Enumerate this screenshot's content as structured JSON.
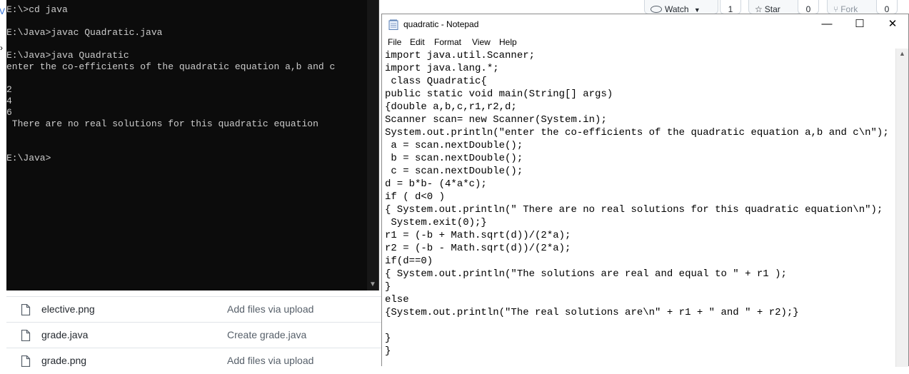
{
  "github": {
    "watch_label": "Watch",
    "watch_count": "1",
    "star_label": "Star",
    "star_count": "0",
    "fork_label": "Fork",
    "fork_count": "0",
    "files": [
      {
        "name": "elective.png",
        "commit": "Add files via upload"
      },
      {
        "name": "grade.java",
        "commit": "Create grade.java"
      },
      {
        "name": "grade.png",
        "commit": "Add files via upload"
      }
    ]
  },
  "cmd": {
    "left_mark": "V",
    "lines": "E:\\>cd java\n\nE:\\Java>javac Quadratic.java\n\nE:\\Java>java Quadratic\nenter the co-efficients of the quadratic equation a,b and c\n\n2\n4\n6\n There are no real solutions for this quadratic equation\n\n\nE:\\Java>"
  },
  "notepad": {
    "title": "quadratic - Notepad",
    "menu": {
      "file": "File",
      "edit": "Edit",
      "format": "Format",
      "view": "View",
      "help": "Help"
    },
    "controls": {
      "minimize": "—",
      "maximize": "☐",
      "close": "✕"
    },
    "code": "import java.util.Scanner;\nimport java.lang.*;\n class Quadratic{\npublic static void main(String[] args)\n{double a,b,c,r1,r2,d;\nScanner scan= new Scanner(System.in);\nSystem.out.println(\"enter the co-efficients of the quadratic equation a,b and c\\n\");\n a = scan.nextDouble();\n b = scan.nextDouble();\n c = scan.nextDouble();\nd = b*b- (4*a*c);\nif ( d<0 )\n{ System.out.println(\" There are no real solutions for this quadratic equation\\n\");\n System.exit(0);}\nr1 = (-b + Math.sqrt(d))/(2*a);\nr2 = (-b - Math.sqrt(d))/(2*a);\nif(d==0)\n{ System.out.println(\"The solutions are real and equal to \" + r1 );\n}\nelse\n{System.out.println(\"The real solutions are\\n\" + r1 + \" and \" + r2);}\n\n}\n}"
  }
}
